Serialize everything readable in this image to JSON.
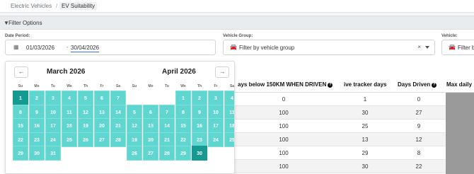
{
  "breadcrumb": [
    "Electric Vehicles",
    "/",
    "EV Suitability"
  ],
  "filter_title": "Filter Options",
  "date_period": {
    "label": "Date Period:",
    "from": "01/03/2026",
    "dash": "-",
    "to": "30/04/2026"
  },
  "vehicle_group": {
    "label": "Vehicle Group:",
    "placeholder": "Filter by vehicle group",
    "clear": "×"
  },
  "vehicle": {
    "label": "Vehicle:",
    "placeholder": "Filter by"
  },
  "datepicker": {
    "prev": "←",
    "next": "→",
    "weekdays": [
      "Su",
      "Mo",
      "Tu",
      "We",
      "Th",
      "Fr",
      "Sa"
    ],
    "months": [
      {
        "title": "March 2026",
        "first_weekday": 0,
        "days": 31,
        "selected": [
          1
        ]
      },
      {
        "title": "April 2026",
        "first_weekday": 3,
        "days": 30,
        "selected": [
          30
        ]
      }
    ]
  },
  "table": {
    "headers": [
      "ays below 150KM WHEN DRIVEN",
      "ive tracker days",
      "Days Driven",
      "Max daily"
    ],
    "rows": [
      [
        "0",
        "1",
        "0"
      ],
      [
        "100",
        "30",
        "27"
      ],
      [
        "100",
        "25",
        "9"
      ],
      [
        "100",
        "13",
        "12"
      ],
      [
        "100",
        "29",
        "8"
      ],
      [
        "100",
        "30",
        "22"
      ]
    ]
  },
  "colors": {
    "range": "#5fd6cf",
    "edge": "#159a92",
    "accent": "#3b74d8"
  }
}
